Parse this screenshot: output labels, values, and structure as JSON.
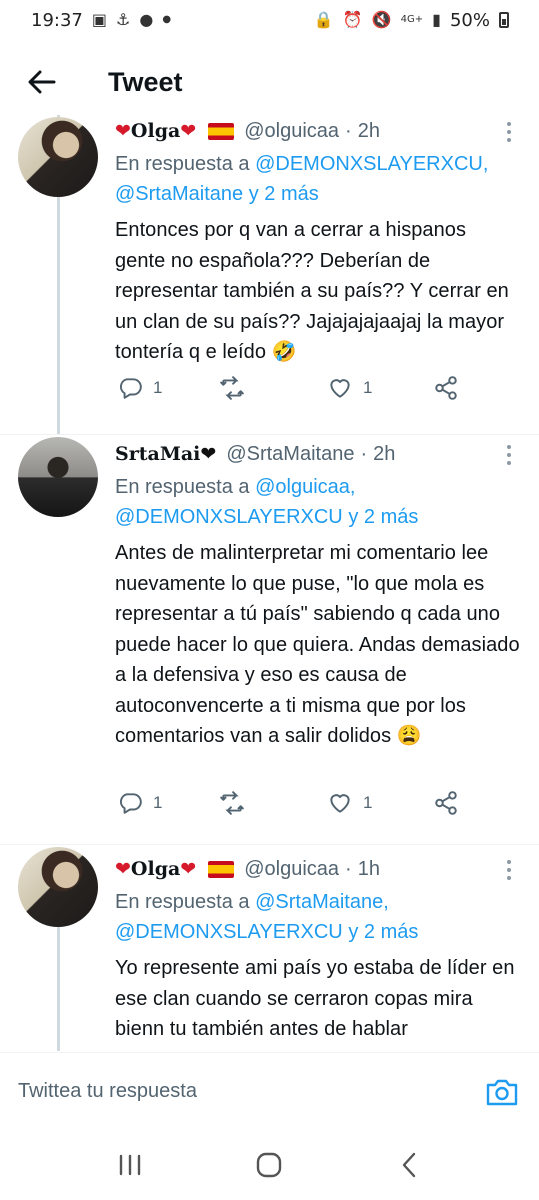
{
  "status_bar": {
    "time": "19:37",
    "network": "4G+",
    "battery": "50%",
    "left_icons": [
      "image-icon",
      "anchor-icon",
      "chat-bubble-icon",
      "dot-icon"
    ],
    "right_icons": [
      "lock-icon",
      "alarm-icon",
      "mute-icon",
      "signal-icon",
      "battery-icon"
    ]
  },
  "header": {
    "title": "Tweet",
    "back_icon": "arrow-left-icon"
  },
  "tweets": [
    {
      "name": "Olga",
      "name_decor": [
        "red-heart",
        "spain-flag"
      ],
      "handle": "@olguicaa",
      "time": "2h",
      "reply_prefix": "En respuesta a",
      "reply_link_1": "@DEMONXSLAYERXCU,",
      "reply_link_2": "@SrtaMaitane",
      "reply_more": "y 2 más",
      "text": "Entonces por q van a cerrar a hispanos gente no española??? Deberían de representar también a su país?? Y cerrar en un clan de su país?? Jajajajajaajaj la mayor tontería q e leído",
      "emoji": "🤣",
      "replies": "1",
      "retweets": "",
      "likes": "1"
    },
    {
      "name": "SrtaMai",
      "name_decor": [
        "black-heart"
      ],
      "handle": "@SrtaMaitane",
      "time": "2h",
      "reply_prefix": "En respuesta a",
      "reply_link_1": "@olguicaa,",
      "reply_link_2": "@DEMONXSLAYERXCU",
      "reply_more": "y 2 más",
      "text": "Antes de malinterpretar mi comentario lee nuevamente lo que puse, \"lo que mola es representar a tú país\" sabiendo q cada uno puede hacer lo que quiera. Andas demasiado a la defensiva y eso es causa de autoconvencerte a ti misma que por los comentarios van a salir dolidos",
      "emoji": "😩",
      "replies": "1",
      "retweets": "",
      "likes": "1"
    },
    {
      "name": "Olga",
      "name_decor": [
        "red-heart",
        "spain-flag"
      ],
      "handle": "@olguicaa",
      "time": "1h",
      "reply_prefix": "En respuesta a",
      "reply_link_1": "@SrtaMaitane,",
      "reply_link_2": "@DEMONXSLAYERXCU",
      "reply_more": "y 2 más",
      "text": "Yo represente ami país yo estaba de líder en ese clan cuando se cerraron copas mira bienn tu también antes de hablar",
      "emoji": ""
    }
  ],
  "composer": {
    "placeholder": "Twittea tu respuesta",
    "camera_icon": "camera-icon"
  },
  "nav_bar": {
    "icons": [
      "recents-icon",
      "home-icon",
      "back-icon"
    ]
  },
  "colors": {
    "accent": "#1d9bf0",
    "secondary_text": "#536471",
    "text": "#0f1419",
    "thread_line": "#cfd9de"
  }
}
